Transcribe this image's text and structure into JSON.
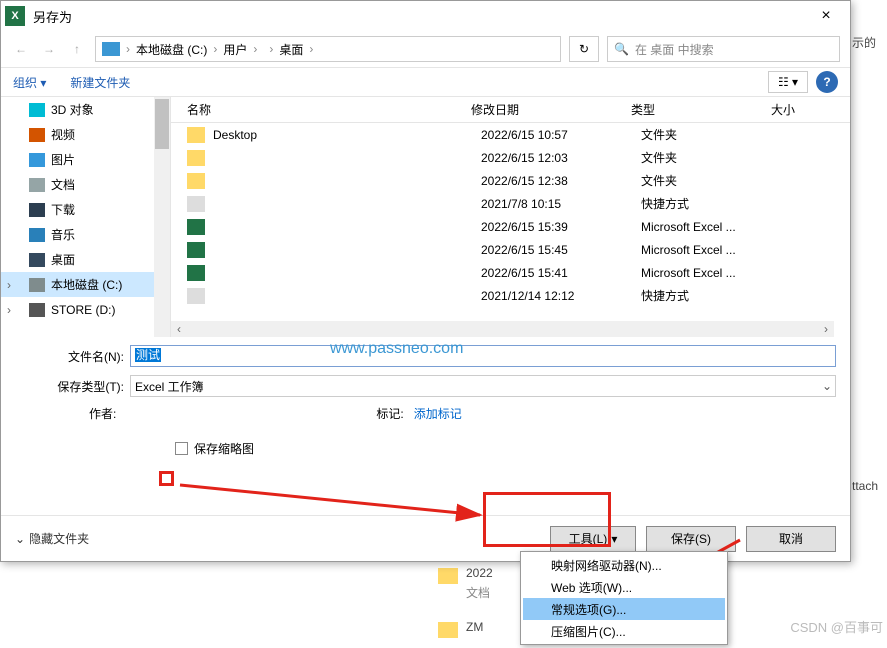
{
  "titlebar": {
    "title": "另存为",
    "close": "×",
    "app": "X"
  },
  "address": {
    "crumbs": [
      "本地磁盘 (C:)",
      "用户",
      " ",
      "桌面"
    ],
    "reload_icon": "↻",
    "search_placeholder": "在 桌面 中搜索"
  },
  "toolbar": {
    "organize": "组织 ▾",
    "new_folder": "新建文件夹",
    "help": "?"
  },
  "tree": [
    {
      "label": "3D 对象",
      "icon": "ic-3d"
    },
    {
      "label": "视频",
      "icon": "ic-video"
    },
    {
      "label": "图片",
      "icon": "ic-picture"
    },
    {
      "label": "文档",
      "icon": "ic-doc"
    },
    {
      "label": "下载",
      "icon": "ic-download"
    },
    {
      "label": "音乐",
      "icon": "ic-music"
    },
    {
      "label": "桌面",
      "icon": "ic-desktop"
    },
    {
      "label": "本地磁盘 (C:)",
      "icon": "ic-disk",
      "selected": true,
      "expand": "›"
    },
    {
      "label": "STORE (D:)",
      "icon": "ic-store",
      "expand": "›"
    }
  ],
  "list": {
    "columns": {
      "name": "名称",
      "date": "修改日期",
      "type": "类型",
      "size": "大小"
    },
    "rows": [
      {
        "icon": "fi-folder",
        "name": "Desktop",
        "date": "2022/6/15 10:57",
        "type": "文件夹"
      },
      {
        "icon": "fi-folder",
        "name": " ",
        "blur": true,
        "date": "2022/6/15 12:03",
        "type": "文件夹"
      },
      {
        "icon": "fi-folder",
        "name": " ",
        "blur": true,
        "date": "2022/6/15 12:38",
        "type": "文件夹"
      },
      {
        "icon": "fi-link",
        "name": " ",
        "blur": true,
        "date": "2021/7/8 10:15",
        "type": "快捷方式"
      },
      {
        "icon": "fi-excel",
        "name": " ",
        "blur": true,
        "date": "2022/6/15 15:39",
        "type": "Microsoft Excel ..."
      },
      {
        "icon": "fi-excel",
        "name": " ",
        "blur": true,
        "date": "2022/6/15 15:45",
        "type": "Microsoft Excel ..."
      },
      {
        "icon": "fi-excel",
        "name": " ",
        "blur": true,
        "date": "2022/6/15 15:41",
        "type": "Microsoft Excel ..."
      },
      {
        "icon": "fi-link",
        "name": " ",
        "blur": true,
        "date": "2021/12/14 12:12",
        "type": "快捷方式"
      }
    ]
  },
  "form": {
    "filename_label": "文件名(N):",
    "filename_value": "测试",
    "type_label": "保存类型(T):",
    "type_value": "Excel 工作簿",
    "author_label": "作者:",
    "author_value": " ",
    "tag_label": "标记:",
    "tag_placeholder": "添加标记",
    "thumb_label": "保存缩略图"
  },
  "footer": {
    "hide_folders": "隐藏文件夹",
    "tools": "工具(L)",
    "save": "保存(S)",
    "cancel": "取消"
  },
  "menu": {
    "items": [
      "映射网络驱动器(N)...",
      "Web 选项(W)...",
      "常规选项(G)...",
      "压缩图片(C)..."
    ]
  },
  "watermark": "www.passneo.com",
  "behind": {
    "year": "2022",
    "doc": "文档",
    "zm": "ZM",
    "side": "示的",
    "attach": "ttach"
  },
  "csdn": "CSDN @百事可"
}
